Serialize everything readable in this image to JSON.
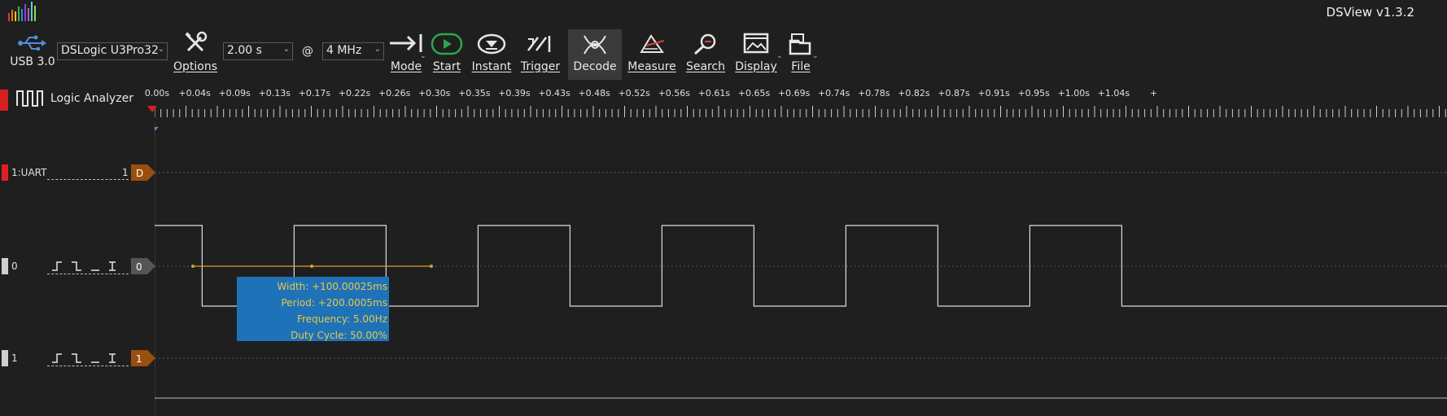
{
  "window": {
    "title": "DSView v1.3.2"
  },
  "toolbar": {
    "usb_label": "USB 3.0",
    "device": "DSLogic U3Pro32",
    "options_label": "Options",
    "duration": "2.00 s",
    "at_symbol": "@",
    "samplerate": "4 MHz",
    "mode_label": "Mode",
    "start_label": "Start",
    "instant_label": "Instant",
    "trigger_label": "Trigger",
    "decode_label": "Decode",
    "measure_label": "Measure",
    "search_label": "Search",
    "display_label": "Display",
    "file_label": "File"
  },
  "panel": {
    "title": "Logic Analyzer"
  },
  "ruler": {
    "ticks": [
      "0.00s",
      "+0.04s",
      "+0.09s",
      "+0.13s",
      "+0.17s",
      "+0.22s",
      "+0.26s",
      "+0.30s",
      "+0.35s",
      "+0.39s",
      "+0.43s",
      "+0.48s",
      "+0.52s",
      "+0.56s",
      "+0.61s",
      "+0.65s",
      "+0.69s",
      "+0.74s",
      "+0.78s",
      "+0.82s",
      "+0.87s",
      "+0.91s",
      "+0.95s",
      "+1.00s",
      "+1.04s",
      "+"
    ]
  },
  "channels": [
    {
      "name": "1:UART",
      "index": "1",
      "tag": "D",
      "marker_color": "#e02020",
      "tag_color": "#9a4f0e"
    },
    {
      "name": "0",
      "index": "",
      "tag": "0",
      "marker_color": "#cfcfcf",
      "tag_color": "#555555"
    },
    {
      "name": "1",
      "index": "",
      "tag": "1",
      "marker_color": "#cfcfcf",
      "tag_color": "#9a4f0e"
    }
  ],
  "measurement": {
    "width": "Width: +100.00025ms",
    "period": "Period: +200.0005ms",
    "frequency": "Frequency: 5.00Hz",
    "duty": "Duty Cycle: 50.00%"
  },
  "waveform": {
    "channel0_transitions_s": [
      0.0,
      0.0517,
      0.1517,
      0.2517,
      0.3517,
      0.4517,
      0.5517,
      0.6517,
      0.7517,
      0.8517,
      0.9517,
      1.0517
    ]
  },
  "colors": {
    "accent": "#1e72b8",
    "start_green": "#2aa84a",
    "measure_line": "#d8a030"
  }
}
